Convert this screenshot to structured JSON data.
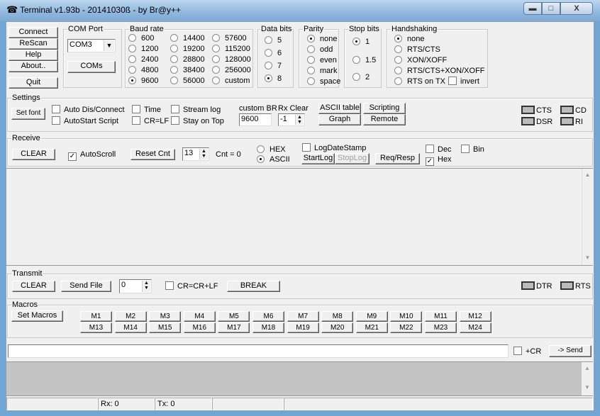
{
  "window": {
    "title": "Terminal v1.93b - 20141030ß - by Br@y++",
    "minimize": "▬",
    "maximize": "□",
    "close": "X"
  },
  "left_buttons": {
    "connect": "Connect",
    "rescan": "ReScan",
    "help": "Help",
    "about": "About..",
    "quit": "Quit"
  },
  "com_port": {
    "label": "COM Port",
    "value": "COM3",
    "coms": "COMs"
  },
  "baud": {
    "label": "Baud rate",
    "options": [
      "600",
      "1200",
      "2400",
      "4800",
      "9600",
      "14400",
      "19200",
      "28800",
      "38400",
      "56000",
      "57600",
      "115200",
      "128000",
      "256000",
      "custom"
    ],
    "selected": "9600"
  },
  "data_bits": {
    "label": "Data bits",
    "options": [
      "5",
      "6",
      "7",
      "8"
    ],
    "selected": "8"
  },
  "parity": {
    "label": "Parity",
    "options": [
      "none",
      "odd",
      "even",
      "mark",
      "space"
    ],
    "selected": "none"
  },
  "stop_bits": {
    "label": "Stop bits",
    "options": [
      "1",
      "1.5",
      "2"
    ],
    "selected": "1"
  },
  "handshaking": {
    "label": "Handshaking",
    "options": [
      "none",
      "RTS/CTS",
      "XON/XOFF",
      "RTS/CTS+XON/XOFF",
      "RTS on TX"
    ],
    "selected": "none",
    "invert": "invert"
  },
  "settings": {
    "label": "Settings",
    "set_font": "Set font",
    "auto_dis": "Auto Dis/Connect",
    "autostart": "AutoStart Script",
    "time": "Time",
    "crlf": "CR=LF",
    "stream_log": "Stream log",
    "stay_on_top": "Stay on Top",
    "custom_br_label": "custom BR",
    "custom_br": "9600",
    "rx_clear_label": "Rx Clear",
    "rx_clear": "-1",
    "ascii_table": "ASCII table",
    "scripting": "Scripting",
    "graph": "Graph",
    "remote": "Remote",
    "cts": "CTS",
    "cd": "CD",
    "dsr": "DSR",
    "ri": "RI"
  },
  "receive": {
    "label": "Receive",
    "clear": "CLEAR",
    "autoscroll": "AutoScroll",
    "reset_cnt": "Reset Cnt",
    "cnt_spin": "13",
    "cnt": "Cnt =  0",
    "hex": "HEX",
    "ascii": "ASCII",
    "log_date": "LogDateStamp",
    "start_log": "StartLog",
    "stop_log": "StopLog",
    "req_resp": "Req/Resp",
    "dec": "Dec",
    "bin": "Bin",
    "hex_chk": "Hex"
  },
  "transmit": {
    "label": "Transmit",
    "clear": "CLEAR",
    "send_file": "Send File",
    "spin": "0",
    "crcrlf": "CR=CR+LF",
    "break": "BREAK",
    "dtr": "DTR",
    "rts": "RTS"
  },
  "macros": {
    "label": "Macros",
    "set_macros": "Set Macros",
    "items": [
      "M1",
      "M2",
      "M3",
      "M4",
      "M5",
      "M6",
      "M7",
      "M8",
      "M9",
      "M10",
      "M11",
      "M12",
      "M13",
      "M14",
      "M15",
      "M16",
      "M17",
      "M18",
      "M19",
      "M20",
      "M21",
      "M22",
      "M23",
      "M24"
    ]
  },
  "send_line": {
    "value": "",
    "plus_cr": "+CR",
    "send": "-> Send"
  },
  "status": {
    "rx": "Rx: 0",
    "tx": "Tx: 0"
  }
}
